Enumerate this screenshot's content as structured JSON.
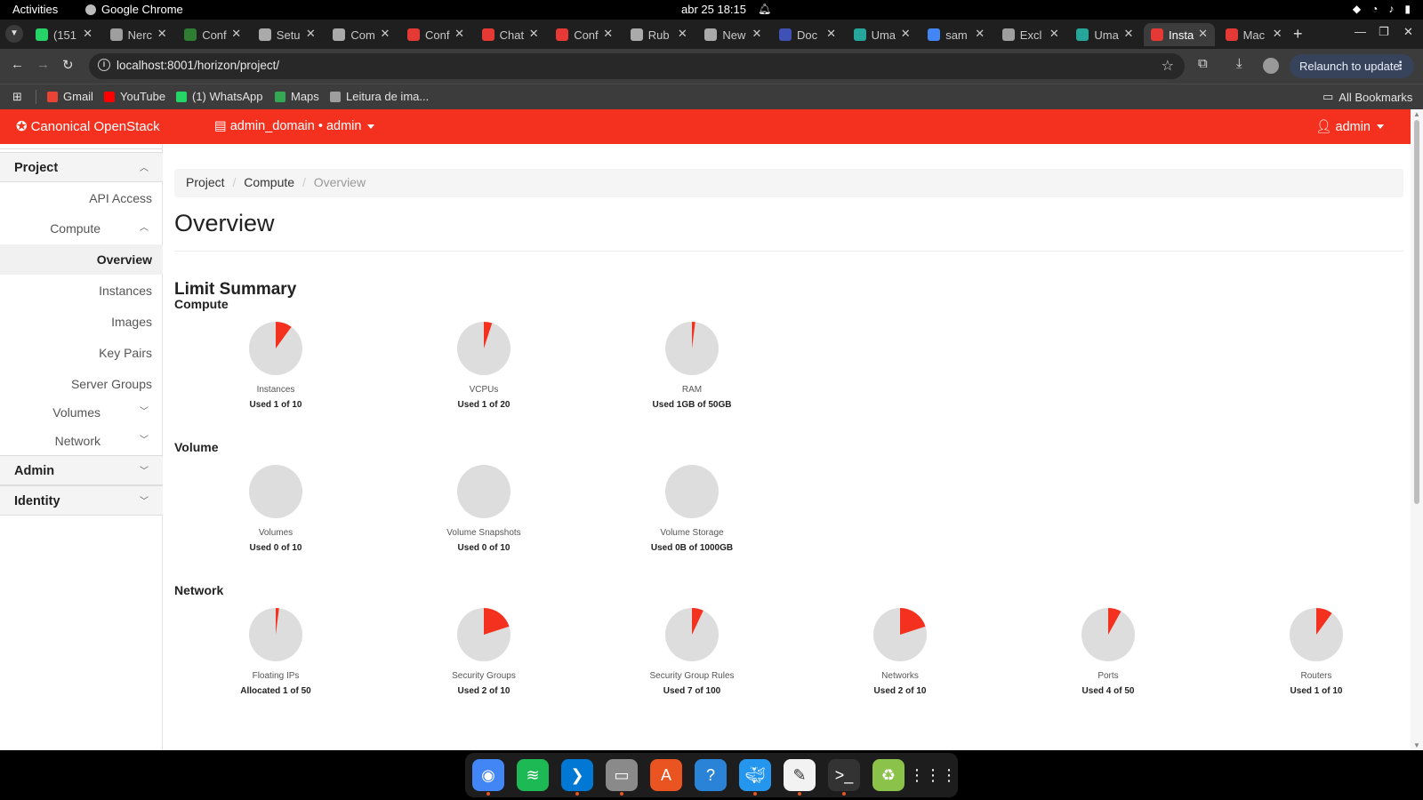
{
  "topbar": {
    "activities": "Activities",
    "app_name": "Google Chrome",
    "clock": "abr 25  18:15"
  },
  "browser": {
    "tabs": [
      {
        "title": "(151",
        "color": "#25d366"
      },
      {
        "title": "Nerc",
        "color": "#9e9e9e"
      },
      {
        "title": "Conf",
        "color": "#2e7d32"
      },
      {
        "title": "Setu",
        "color": "#aaaaaa"
      },
      {
        "title": "Com",
        "color": "#aaaaaa"
      },
      {
        "title": "Conf",
        "color": "#e53935"
      },
      {
        "title": "Chat",
        "color": "#e53935"
      },
      {
        "title": "Conf",
        "color": "#e53935"
      },
      {
        "title": "Rub",
        "color": "#aaaaaa"
      },
      {
        "title": "New",
        "color": "#aaaaaa"
      },
      {
        "title": "Doc",
        "color": "#3f51b5"
      },
      {
        "title": "Uma",
        "color": "#26a69a"
      },
      {
        "title": "sam",
        "color": "#4285f4"
      },
      {
        "title": "Excl",
        "color": "#9e9e9e"
      },
      {
        "title": "Uma",
        "color": "#26a69a"
      },
      {
        "title": "Insta",
        "color": "#e53935"
      },
      {
        "title": "Mac",
        "color": "#e53935"
      }
    ],
    "active_tab_index": 15,
    "url": "localhost:8001/horizon/project/",
    "relaunch_label": "Relaunch to update",
    "bookmarks": [
      {
        "label": "Gmail",
        "color": "#ea4335"
      },
      {
        "label": "YouTube",
        "color": "#ff0000"
      },
      {
        "label": "(1) WhatsApp",
        "color": "#25d366"
      },
      {
        "label": "Maps",
        "color": "#34a853"
      },
      {
        "label": "Leitura de ima...",
        "color": "#9e9e9e"
      }
    ],
    "all_bookmarks": "All Bookmarks"
  },
  "header": {
    "brand": "Canonical OpenStack",
    "project_selector": "admin_domain • admin",
    "user": "admin",
    "accent_color": "#f4311f"
  },
  "sidebar": {
    "project": "Project",
    "api_access": "API Access",
    "compute": "Compute",
    "compute_items": [
      "Overview",
      "Instances",
      "Images",
      "Key Pairs",
      "Server Groups"
    ],
    "volumes": "Volumes",
    "network": "Network",
    "admin": "Admin",
    "identity": "Identity"
  },
  "breadcrumb": [
    "Project",
    "Compute",
    "Overview"
  ],
  "page_title": "Overview",
  "limit_summary": {
    "title": "Limit Summary",
    "groups": [
      {
        "title": "Compute",
        "items": [
          {
            "label": "Instances",
            "used_text": "Used 1 of 10",
            "fraction": 0.1
          },
          {
            "label": "VCPUs",
            "used_text": "Used 1 of 20",
            "fraction": 0.05
          },
          {
            "label": "RAM",
            "used_text": "Used 1GB of 50GB",
            "fraction": 0.02
          }
        ]
      },
      {
        "title": "Volume",
        "items": [
          {
            "label": "Volumes",
            "used_text": "Used 0 of 10",
            "fraction": 0
          },
          {
            "label": "Volume Snapshots",
            "used_text": "Used 0 of 10",
            "fraction": 0
          },
          {
            "label": "Volume Storage",
            "used_text": "Used 0B of 1000GB",
            "fraction": 0
          }
        ]
      },
      {
        "title": "Network",
        "items": [
          {
            "label": "Floating IPs",
            "used_text": "Allocated 1 of 50",
            "fraction": 0.02
          },
          {
            "label": "Security Groups",
            "used_text": "Used 2 of 10",
            "fraction": 0.2
          },
          {
            "label": "Security Group Rules",
            "used_text": "Used 7 of 100",
            "fraction": 0.07
          },
          {
            "label": "Networks",
            "used_text": "Used 2 of 10",
            "fraction": 0.2
          },
          {
            "label": "Ports",
            "used_text": "Used 4 of 50",
            "fraction": 0.08
          },
          {
            "label": "Routers",
            "used_text": "Used 1 of 10",
            "fraction": 0.1
          }
        ]
      }
    ],
    "pie_used_color": "#f4311f",
    "pie_free_color": "#dddddd"
  },
  "dock": [
    {
      "name": "chrome-icon",
      "color": "#4285f4"
    },
    {
      "name": "spotify-icon",
      "color": "#1db954"
    },
    {
      "name": "vscode-icon",
      "color": "#0078d4"
    },
    {
      "name": "files-icon",
      "color": "#8a8a8a"
    },
    {
      "name": "software-store-icon",
      "color": "#e95420"
    },
    {
      "name": "help-icon",
      "color": "#2a83d7"
    },
    {
      "name": "docker-icon",
      "color": "#2496ed"
    },
    {
      "name": "text-editor-icon",
      "color": "#f2f2f2"
    },
    {
      "name": "terminal-icon",
      "color": "#333333"
    },
    {
      "name": "trash-icon",
      "color": "#8bc34a"
    },
    {
      "name": "app-grid-icon",
      "color": "#1d1d1d"
    }
  ]
}
